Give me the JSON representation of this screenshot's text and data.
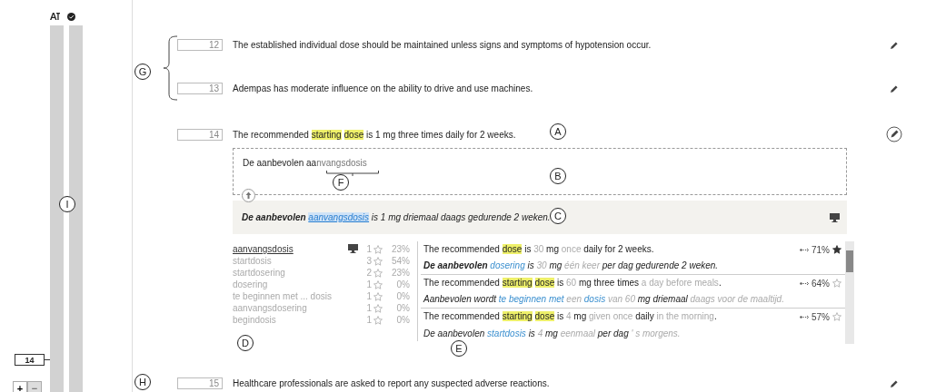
{
  "rail": {
    "position_marker": "14",
    "zoom_buttons": [
      "+",
      "−"
    ]
  },
  "segments": [
    {
      "number": "12",
      "active": false,
      "source": [
        {
          "kind": "plain",
          "text": "The established individual dose should be maintained unless signs and symptoms of hypotension occur."
        }
      ]
    },
    {
      "number": "13",
      "active": false,
      "source": [
        {
          "kind": "plain",
          "text": "Adempas has moderate influence on the ability to drive and use machines."
        }
      ]
    },
    {
      "number": "14",
      "active": true,
      "source": [
        {
          "kind": "plain",
          "text": "The recommended "
        },
        {
          "kind": "highlight",
          "text": "starting"
        },
        {
          "kind": "highlight",
          "text": "dose"
        },
        {
          "kind": "plain",
          "text": " is 1 mg three times daily for 2 weeks."
        }
      ]
    },
    {
      "number": "15",
      "active": false,
      "source": [
        {
          "kind": "plain",
          "text": "Healthcare professionals are asked to report any suspected adverse reactions."
        }
      ]
    }
  ],
  "editor": {
    "typed": "De aanbevolen aa",
    "completion": "nvangsdosis"
  },
  "machine_translation": [
    {
      "kind": "bold",
      "text": "De aanbevolen "
    },
    {
      "kind": "selected_term",
      "text": "aanvangsdosis"
    },
    {
      "kind": "plain",
      "text": " is 1 mg driemaal daags gedurende 2 weken."
    }
  ],
  "terms": [
    {
      "term": "aanvangsdosis",
      "selected": true,
      "machine": true,
      "count": "1",
      "percent": "23%"
    },
    {
      "term": "startdosis",
      "selected": false,
      "machine": false,
      "count": "3",
      "percent": "54%"
    },
    {
      "term": "startdosering",
      "selected": false,
      "machine": false,
      "count": "2",
      "percent": "23%"
    },
    {
      "term": "dosering",
      "selected": false,
      "machine": false,
      "count": "1",
      "percent": "0%"
    },
    {
      "term": "te beginnen met ... dosis",
      "selected": false,
      "machine": false,
      "count": "1",
      "percent": "0%"
    },
    {
      "term": "aanvangsdosering",
      "selected": false,
      "machine": false,
      "count": "1",
      "percent": "0%"
    },
    {
      "term": "begindosis",
      "selected": false,
      "machine": false,
      "count": "1",
      "percent": "0%"
    }
  ],
  "matches": [
    {
      "score": "71%",
      "starred": true,
      "source": [
        {
          "kind": "plain",
          "text": "The recommended "
        },
        {
          "kind": "highlight",
          "text": "dose"
        },
        {
          "kind": "plain",
          "text": " is "
        },
        {
          "kind": "muted",
          "text": "30"
        },
        {
          "kind": "plain",
          "text": " mg "
        },
        {
          "kind": "muted",
          "text": "once"
        },
        {
          "kind": "plain",
          "text": " daily for 2 weeks."
        }
      ],
      "target": [
        {
          "kind": "bold",
          "text": "De aanbevolen "
        },
        {
          "kind": "term",
          "text": "dosering"
        },
        {
          "kind": "plain",
          "text": " is "
        },
        {
          "kind": "muted",
          "text": "30"
        },
        {
          "kind": "plain",
          "text": " mg "
        },
        {
          "kind": "muted",
          "text": "één keer"
        },
        {
          "kind": "plain",
          "text": " per dag gedurende 2 weken."
        }
      ]
    },
    {
      "score": "64%",
      "starred": false,
      "source": [
        {
          "kind": "plain",
          "text": "The recommended "
        },
        {
          "kind": "highlight",
          "text": "starting"
        },
        {
          "kind": "highlight",
          "text": "dose"
        },
        {
          "kind": "plain",
          "text": " is "
        },
        {
          "kind": "muted",
          "text": "60"
        },
        {
          "kind": "plain",
          "text": " mg three times "
        },
        {
          "kind": "muted",
          "text": "a day before meals"
        },
        {
          "kind": "plain",
          "text": "."
        }
      ],
      "target": [
        {
          "kind": "plain",
          "text": "Aanbevolen wordt "
        },
        {
          "kind": "term",
          "text": "te beginnen met"
        },
        {
          "kind": "muted",
          "text": " een "
        },
        {
          "kind": "term",
          "text": "dosis"
        },
        {
          "kind": "muted",
          "text": " van 60"
        },
        {
          "kind": "plain",
          "text": " mg driemaal "
        },
        {
          "kind": "muted",
          "text": "daags voor de maaltijd."
        }
      ]
    },
    {
      "score": "57%",
      "starred": false,
      "source": [
        {
          "kind": "plain",
          "text": "The recommended "
        },
        {
          "kind": "highlight",
          "text": "starting"
        },
        {
          "kind": "highlight",
          "text": "dose"
        },
        {
          "kind": "plain",
          "text": " is "
        },
        {
          "kind": "muted",
          "text": "4"
        },
        {
          "kind": "plain",
          "text": " mg "
        },
        {
          "kind": "muted",
          "text": "given once"
        },
        {
          "kind": "plain",
          "text": " daily "
        },
        {
          "kind": "muted",
          "text": "in the morning"
        },
        {
          "kind": "plain",
          "text": "."
        }
      ],
      "target": [
        {
          "kind": "plain",
          "text": "De aanbevolen "
        },
        {
          "kind": "term",
          "text": "startdosis"
        },
        {
          "kind": "plain",
          "text": " is "
        },
        {
          "kind": "muted",
          "text": "4"
        },
        {
          "kind": "plain",
          "text": " mg "
        },
        {
          "kind": "muted",
          "text": "eenmaal"
        },
        {
          "kind": "plain",
          "text": " per dag "
        },
        {
          "kind": "muted",
          "text": "' s morgens."
        }
      ]
    }
  ],
  "callouts": [
    {
      "letter": "A"
    },
    {
      "letter": "B"
    },
    {
      "letter": "C"
    },
    {
      "letter": "D"
    },
    {
      "letter": "E"
    },
    {
      "letter": "F"
    },
    {
      "letter": "G"
    },
    {
      "letter": "H"
    },
    {
      "letter": "I"
    }
  ]
}
